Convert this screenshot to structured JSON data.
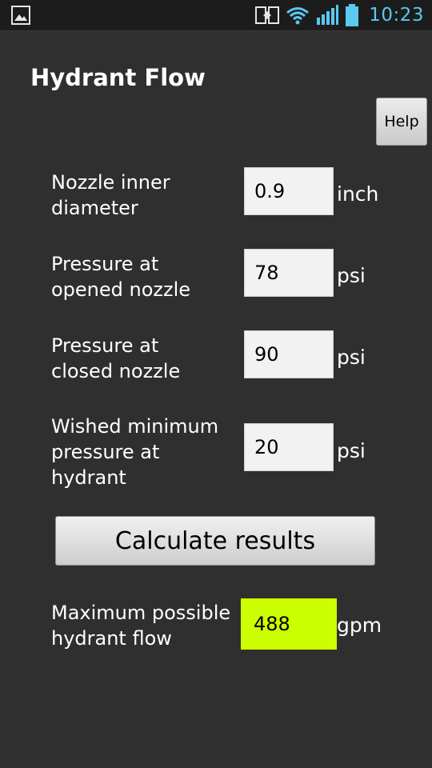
{
  "status_bar": {
    "time": "10:23",
    "icons": [
      "gallery-icon",
      "screen-mirroring-icon",
      "wifi-icon",
      "signal-icon",
      "battery-icon"
    ],
    "clock_color": "#5ac8ef"
  },
  "app": {
    "title": "Hydrant Flow",
    "help_label": "Help"
  },
  "fields": [
    {
      "label_line1": "Nozzle inner",
      "label_line2": "diameter",
      "label_line3": "",
      "value": "0.9",
      "unit": "inch"
    },
    {
      "label_line1": "Pressure at",
      "label_line2": "opened nozzle",
      "label_line3": "",
      "value": "78",
      "unit": "psi"
    },
    {
      "label_line1": "Pressure at",
      "label_line2": "closed nozzle",
      "label_line3": "",
      "value": "90",
      "unit": "psi"
    },
    {
      "label_line1": "Wished minimum",
      "label_line2": "pressure at",
      "label_line3": "hydrant",
      "value": "20",
      "unit": "psi"
    }
  ],
  "calculate_label": "Calculate results",
  "result": {
    "label_line1": "Maximum possible",
    "label_line2": "hydrant flow",
    "value": "488",
    "unit": "gpm",
    "highlight_color": "#ccff00"
  }
}
